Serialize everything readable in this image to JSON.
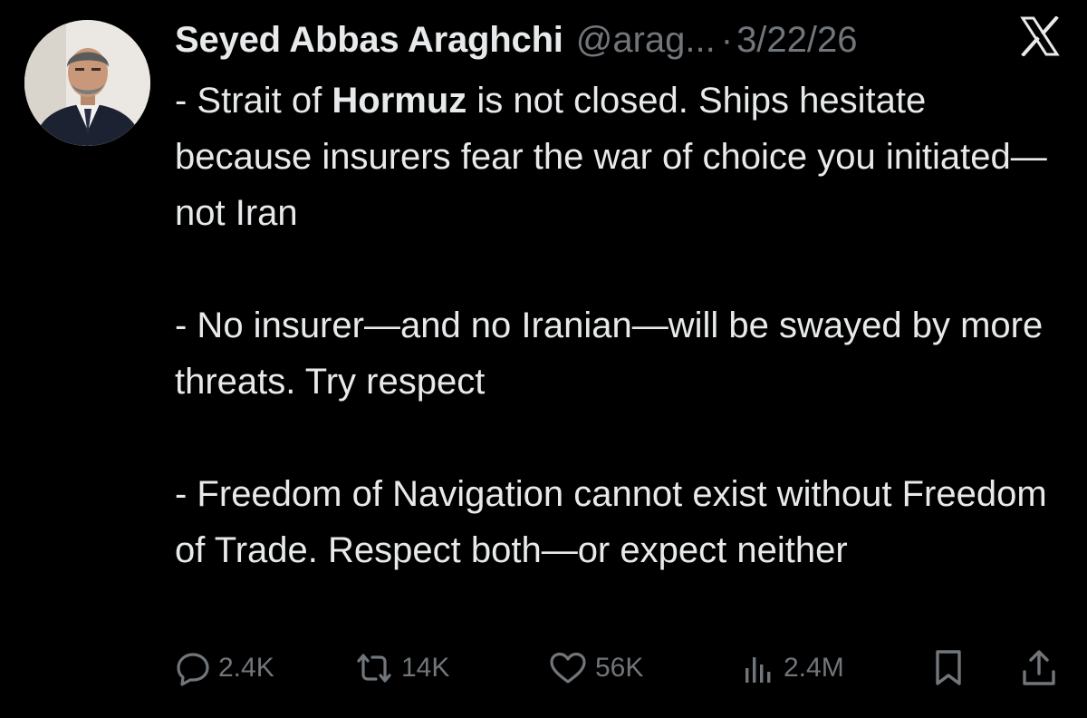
{
  "author": {
    "name": "Seyed Abbas Araghchi",
    "handle": "@arag...",
    "separator": "·",
    "date": "3/22/26",
    "avatar_icon": "profile-photo"
  },
  "platform_icon": "x-logo-icon",
  "post": {
    "p1": {
      "before": "- Strait of ",
      "bold": "Hormuz",
      "after": " is not closed. Ships hesitate because insurers fear the war of choice you initiated—not Iran"
    },
    "p2": "- No insurer—and no Iranian—will be swayed by more threats. Try respect",
    "p3": "- Freedom of Navigation cannot exist without Freedom of Trade. Respect both—or expect neither"
  },
  "metrics": {
    "replies": "2.4K",
    "reposts": "14K",
    "likes": "56K",
    "views": "2.4M"
  },
  "colors": {
    "background": "#000000",
    "text": "#e7e9ea",
    "muted": "#71767b"
  }
}
